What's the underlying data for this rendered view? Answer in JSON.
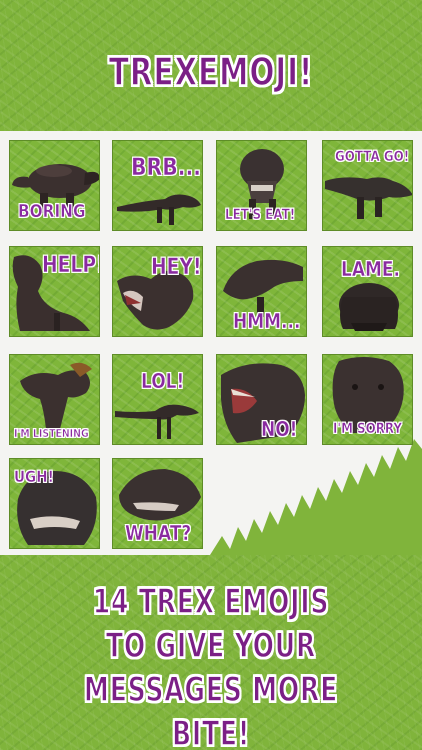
{
  "app": {
    "title": "TREXEMOJI!"
  },
  "colors": {
    "grass": "#80b43b",
    "title_purple": "#7b1f86",
    "label_purple": "#8a2aa0",
    "panel_bg": "#f4f4f2"
  },
  "stickers": [
    {
      "label": "BORING",
      "icon": "trex-lying-icon"
    },
    {
      "label": "BRB...",
      "icon": "trex-running-icon"
    },
    {
      "label": "LET'S EAT!",
      "icon": "trex-front-icon"
    },
    {
      "label": "GOTTA GO!",
      "icon": "trex-walking-icon"
    },
    {
      "label": "HELP!",
      "icon": "trex-lying-icon"
    },
    {
      "label": "HEY!",
      "icon": "trex-roaring-icon"
    },
    {
      "label": "HMM...",
      "icon": "trex-walking-icon"
    },
    {
      "label": "LAME.",
      "icon": "trex-front-icon"
    },
    {
      "label": "I'M LISTENING",
      "icon": "trex-standing-icon"
    },
    {
      "label": "LOL!",
      "icon": "trex-running-icon"
    },
    {
      "label": "NO!",
      "icon": "trex-head-icon"
    },
    {
      "label": "I'M SORRY",
      "icon": "trex-head-icon"
    },
    {
      "label": "UGH!",
      "icon": "trex-head-icon"
    },
    {
      "label": "WHAT?",
      "icon": "trex-head-icon"
    }
  ],
  "footer": {
    "line1": "14 TREX EMOJIS",
    "line2": "TO GIVE YOUR",
    "line3": "MESSAGES MORE BITE!"
  }
}
